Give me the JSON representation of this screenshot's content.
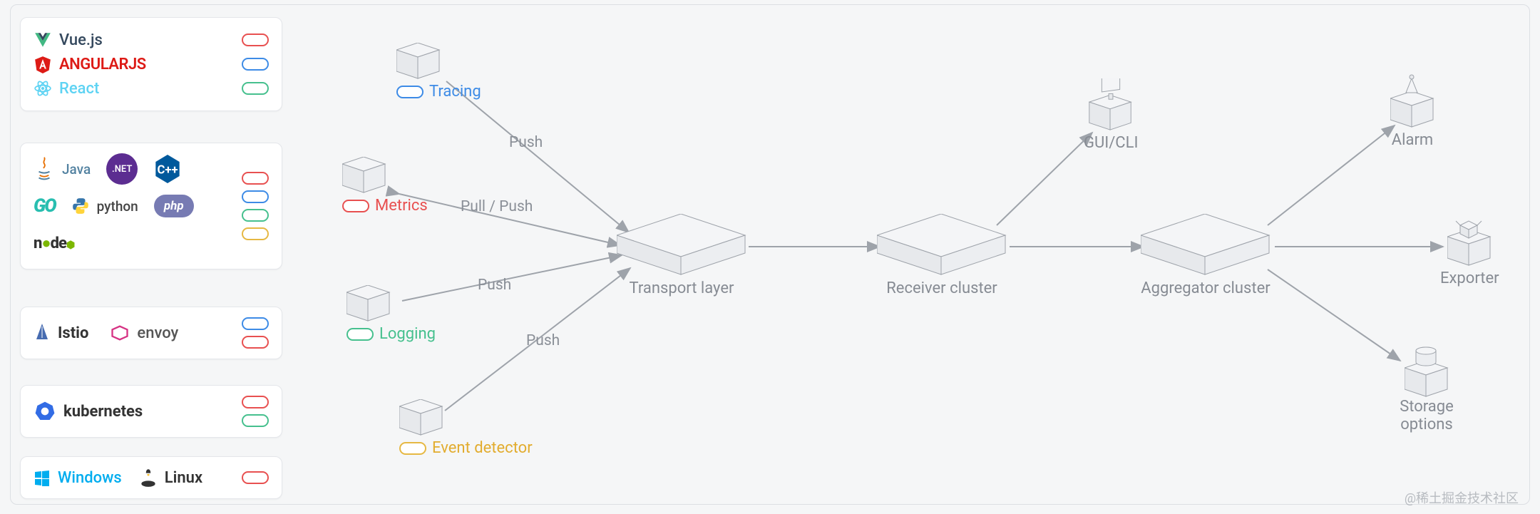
{
  "watermark": "@稀土掘金技术社区",
  "sidebar": {
    "panel_frontend": {
      "items": [
        {
          "name": "Vue.js",
          "logo": "vue",
          "color": "#42b883",
          "pill": "red"
        },
        {
          "name": "ANGULARJS",
          "logo": "angular",
          "color": "#dd1b16",
          "pill": "blue"
        },
        {
          "name": "React",
          "logo": "react",
          "color": "#5ed3f3",
          "pill": "green"
        }
      ]
    },
    "panel_languages": {
      "logos": [
        "Java",
        ".NET Core",
        "C++",
        "GO",
        "python",
        "php",
        "node"
      ],
      "pills": [
        "red",
        "blue",
        "green",
        "yellow"
      ]
    },
    "panel_mesh": {
      "items": [
        "Istio",
        "envoy"
      ],
      "pills": [
        "blue",
        "red"
      ]
    },
    "panel_k8s": {
      "items": [
        "kubernetes"
      ],
      "pills": [
        "red",
        "green"
      ]
    },
    "panel_os": {
      "items": [
        "Windows",
        "Linux"
      ],
      "pills": [
        "red"
      ]
    }
  },
  "sources": {
    "tracing": {
      "label": "Tracing",
      "pill": "blue",
      "edge": "Push"
    },
    "metrics": {
      "label": "Metrics",
      "pill": "red",
      "edge": "Pull / Push"
    },
    "logging": {
      "label": "Logging",
      "pill": "green",
      "edge": "Push"
    },
    "eventdetector": {
      "label": "Event detector",
      "pill": "yellow",
      "edge": "Push"
    }
  },
  "nodes": {
    "transport": {
      "label": "Transport layer"
    },
    "receiver": {
      "label": "Receiver cluster"
    },
    "aggregator": {
      "label": "Aggregator cluster"
    },
    "guicli": {
      "label": "GUI/CLI"
    },
    "alarm": {
      "label": "Alarm"
    },
    "exporter": {
      "label": "Exporter"
    },
    "storage": {
      "label": "Storage options"
    }
  },
  "colors": {
    "red": "#e85050",
    "blue": "#3d8be6",
    "green": "#46c08e",
    "yellow": "#e2ac2e",
    "text_muted": "#868b93",
    "line": "#9ea3aa"
  }
}
